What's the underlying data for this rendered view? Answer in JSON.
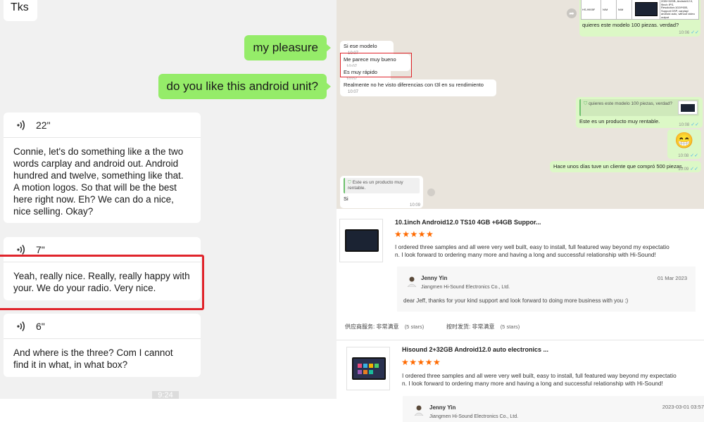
{
  "left_chat": {
    "partial_top_text": "Tks",
    "out_messages": [
      "my pleasure",
      "do you like this android unit?"
    ],
    "voice_messages": [
      {
        "duration": "22\"",
        "transcript": "Connie, let's do something like a the two words carplay and android out. Android hundred and twelve, something like that. A motion logos. So that will be the best here right now. Eh? We can do a nice, nice selling. Okay?"
      },
      {
        "duration": "7\"",
        "transcript": "Yeah, really nice. Really, really happy with your. We do your radio. Very nice."
      },
      {
        "duration": "6\"",
        "transcript": "And where is the three? Com I cannot find it in what, in what box?"
      }
    ],
    "timestamp": "9:24"
  },
  "whatsapp": {
    "product_table": {
      "cells": [
        "HS-9905F",
        "N/M",
        "N/M"
      ],
      "spec": "2GB+32GB, Android12.0, 9inch IPS, Resolution:1024*600, Support DSP, carplay/ android auto, without video output"
    },
    "messages": [
      {
        "text": "quieres este modelo 100 piezas. verdad?",
        "time": "10:06"
      },
      {
        "text": "Si ese modelo",
        "time": "10:07"
      },
      {
        "text": "Me parece muy bueno",
        "time": "10:07"
      },
      {
        "text": "Es muy rápido",
        "time": "10:07"
      },
      {
        "text": "Realmente no he visto diferencias con t3l en su rendimiento",
        "time": "10:07"
      },
      {
        "quote": "quieres este modelo 100 piezas, verdad?",
        "text": "Este es un producto muy rentable.",
        "time": "10:08"
      },
      {
        "emoji": "😁",
        "time": "10:08"
      },
      {
        "text": "Hace unos días tuve un cliente que compró 500 piezas.",
        "time": "10:09"
      },
      {
        "quote": "Este es un producto muy rentable.",
        "text": "Si",
        "time": "10:09"
      }
    ]
  },
  "reviews": [
    {
      "title": "10.1inch Android12.0 TS10 4GB +64GB Suppor...",
      "stars": "★★★★★",
      "text_line1": "I ordered three samples and all were very well built, easy to install, full featured way beyond my expectatio",
      "text_line2": "n. I look forward to ordering many more and having a long and successful relationship with Hi-Sound!",
      "reply_name": "Jenny Yin",
      "reply_company": "Jiangmen Hi-Sound Electronics Co., Ltd.",
      "reply_date": "01 Mar 2023",
      "reply_text": "dear Jeff, thanks for your kind support and look forward to doing more business with you :)",
      "rating1_label": "供应商服务: 非常满意",
      "rating1_stars": "(5 stars)",
      "rating2_label": "按时发货: 非常满意",
      "rating2_stars": "(5 stars)"
    },
    {
      "title": "Hisound 2+32GB Android12.0 auto electronics ...",
      "stars": "★★★★★",
      "text_line1": "I ordered three samples and all were very well built, easy to install, full featured way beyond my expectatio",
      "text_line2": "n. I look forward to ordering many more and having a long and successful relationship with Hi-Sound!",
      "reply_name": "Jenny Yin",
      "reply_company": "Jiangmen Hi-Sound Electronics Co., Ltd.",
      "reply_date": "2023-03-01 03:57"
    }
  ],
  "colors": {
    "wechat_green": "#95ec69",
    "whatsapp_out": "#dcf8c6",
    "star_orange": "#ff6a00",
    "highlight_red": "#e0242b",
    "whatsapp_tick": "#4fb6ec"
  }
}
